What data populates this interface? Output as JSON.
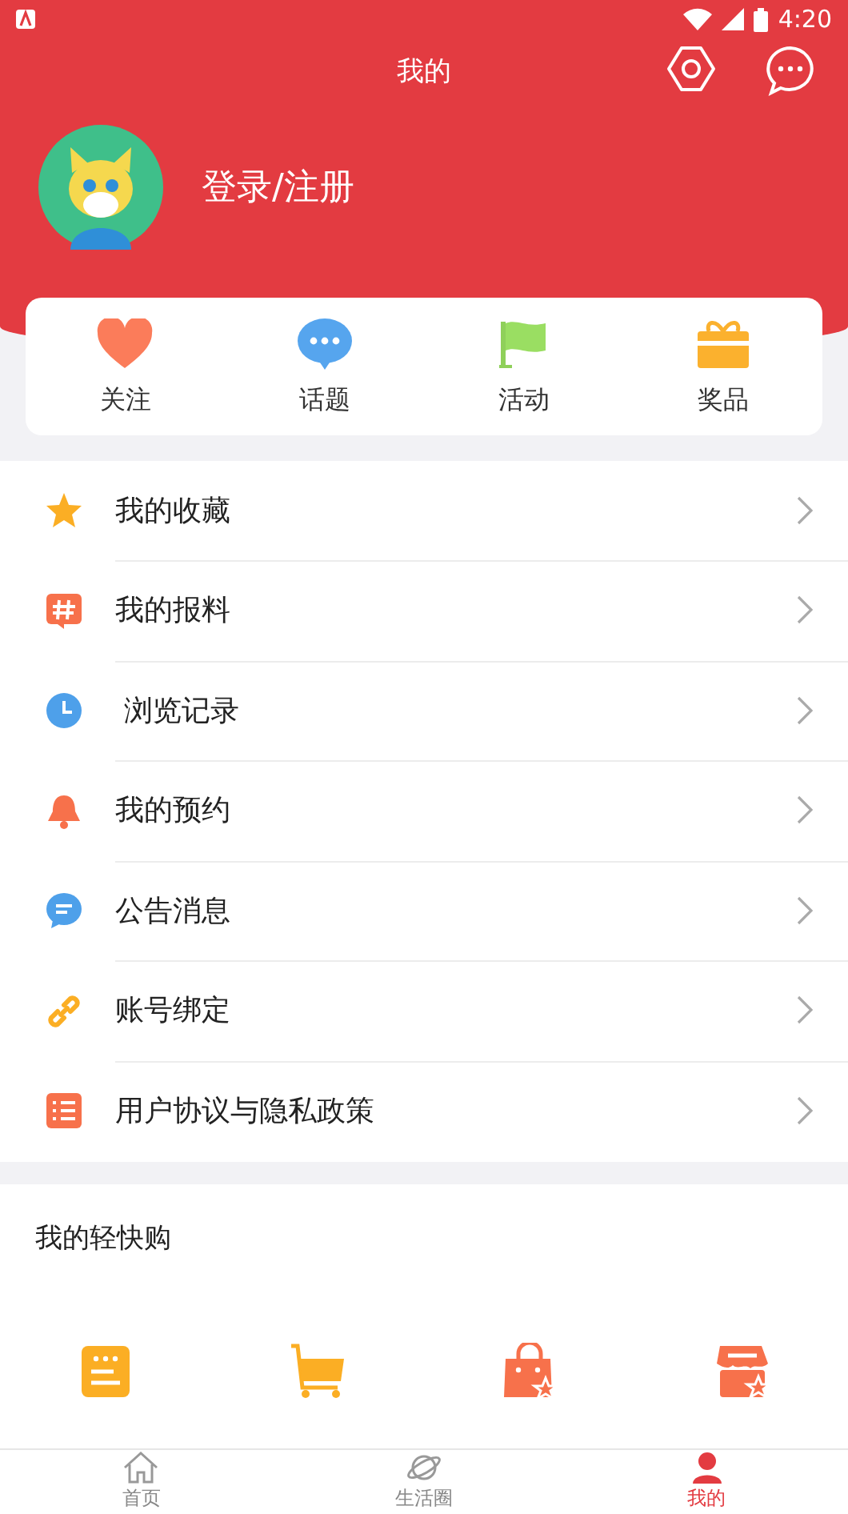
{
  "status_bar": {
    "time": "4:20"
  },
  "header": {
    "title": "我的",
    "login": "登录/注册"
  },
  "quick_actions": [
    {
      "label": "关注"
    },
    {
      "label": "话题"
    },
    {
      "label": "活动"
    },
    {
      "label": "奖品"
    }
  ],
  "menu": [
    {
      "label": "我的收藏"
    },
    {
      "label": "我的报料"
    },
    {
      "label": " 浏览记录"
    },
    {
      "label": "我的预约"
    },
    {
      "label": "公告消息"
    },
    {
      "label": "账号绑定"
    },
    {
      "label": "用户协议与隐私政策"
    }
  ],
  "shopping": {
    "title": "我的轻快购"
  },
  "tabs": [
    {
      "label": "首页",
      "selected": false
    },
    {
      "label": "生活圈",
      "selected": false
    },
    {
      "label": "我的",
      "selected": true
    }
  ]
}
